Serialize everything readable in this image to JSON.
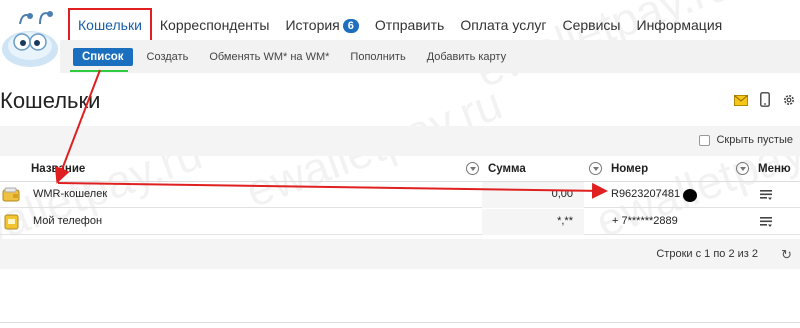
{
  "nav": {
    "items": [
      {
        "label": "Кошельки",
        "active": true
      },
      {
        "label": "Корреспонденты"
      },
      {
        "label": "История",
        "badge": "6"
      },
      {
        "label": "Отправить"
      },
      {
        "label": "Оплата услуг"
      },
      {
        "label": "Сервисы"
      },
      {
        "label": "Информация"
      }
    ]
  },
  "subnav": {
    "items": [
      {
        "label": "Список",
        "active": true
      },
      {
        "label": "Создать"
      },
      {
        "label": "Обменять WM* на WM*"
      },
      {
        "label": "Пополнить"
      },
      {
        "label": "Добавить карту"
      }
    ]
  },
  "page": {
    "title": "Кошельки"
  },
  "toolbar": {
    "hide_empty_label": "Скрыть пустые"
  },
  "table": {
    "columns": {
      "name": "Название",
      "sum": "Сумма",
      "number": "Номер",
      "menu": "Меню"
    },
    "rows": [
      {
        "name": "WMR-кошелек",
        "sum": "0,00",
        "number": "R9623207481"
      },
      {
        "name": "Мой телефон",
        "sum": "*,**",
        "number": "+ 7******2889"
      }
    ]
  },
  "footer": {
    "info": "Строки с 1 по 2 из 2"
  },
  "watermark": "ewalletpay.ru",
  "colors": {
    "accent": "#1a6fbf",
    "annotation": "#e02020",
    "highlight": "#2ecc40"
  }
}
